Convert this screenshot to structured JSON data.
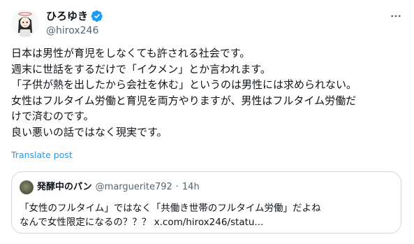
{
  "author": {
    "display_name": "ひろゆき",
    "handle": "@hirox246",
    "avatar_icon": "avatar-illustration",
    "verified_icon": "verified-badge-icon",
    "verified_color": "#1d9bf0"
  },
  "more_icon": "more-horizontal-icon",
  "tweet": {
    "lines": [
      "日本は男性が育児をしなくても許される社会です。",
      "週末に世話をするだけで「イクメン」とか言われます。",
      "「子供が熱を出したから会社を休む」というのは男性には求められない。",
      "女性はフルタイム労働と育児を両方やりますが、男性はフルタイム労働だ",
      "けで済むのです。",
      "良い悪いの話ではなく現実です。"
    ]
  },
  "translate_label": "Translate post",
  "accent_color": "#1d9bf0",
  "quote": {
    "display_name": "発酵中のパン",
    "handle": "@marguerite792",
    "separator": "·",
    "time": "14h",
    "lines": [
      "「女性のフルタイム」ではなく「共働き世帯のフルタイム労働」だよね",
      "なんで女性限定になるの？？？ x.com/hirox246/statu..."
    ]
  }
}
